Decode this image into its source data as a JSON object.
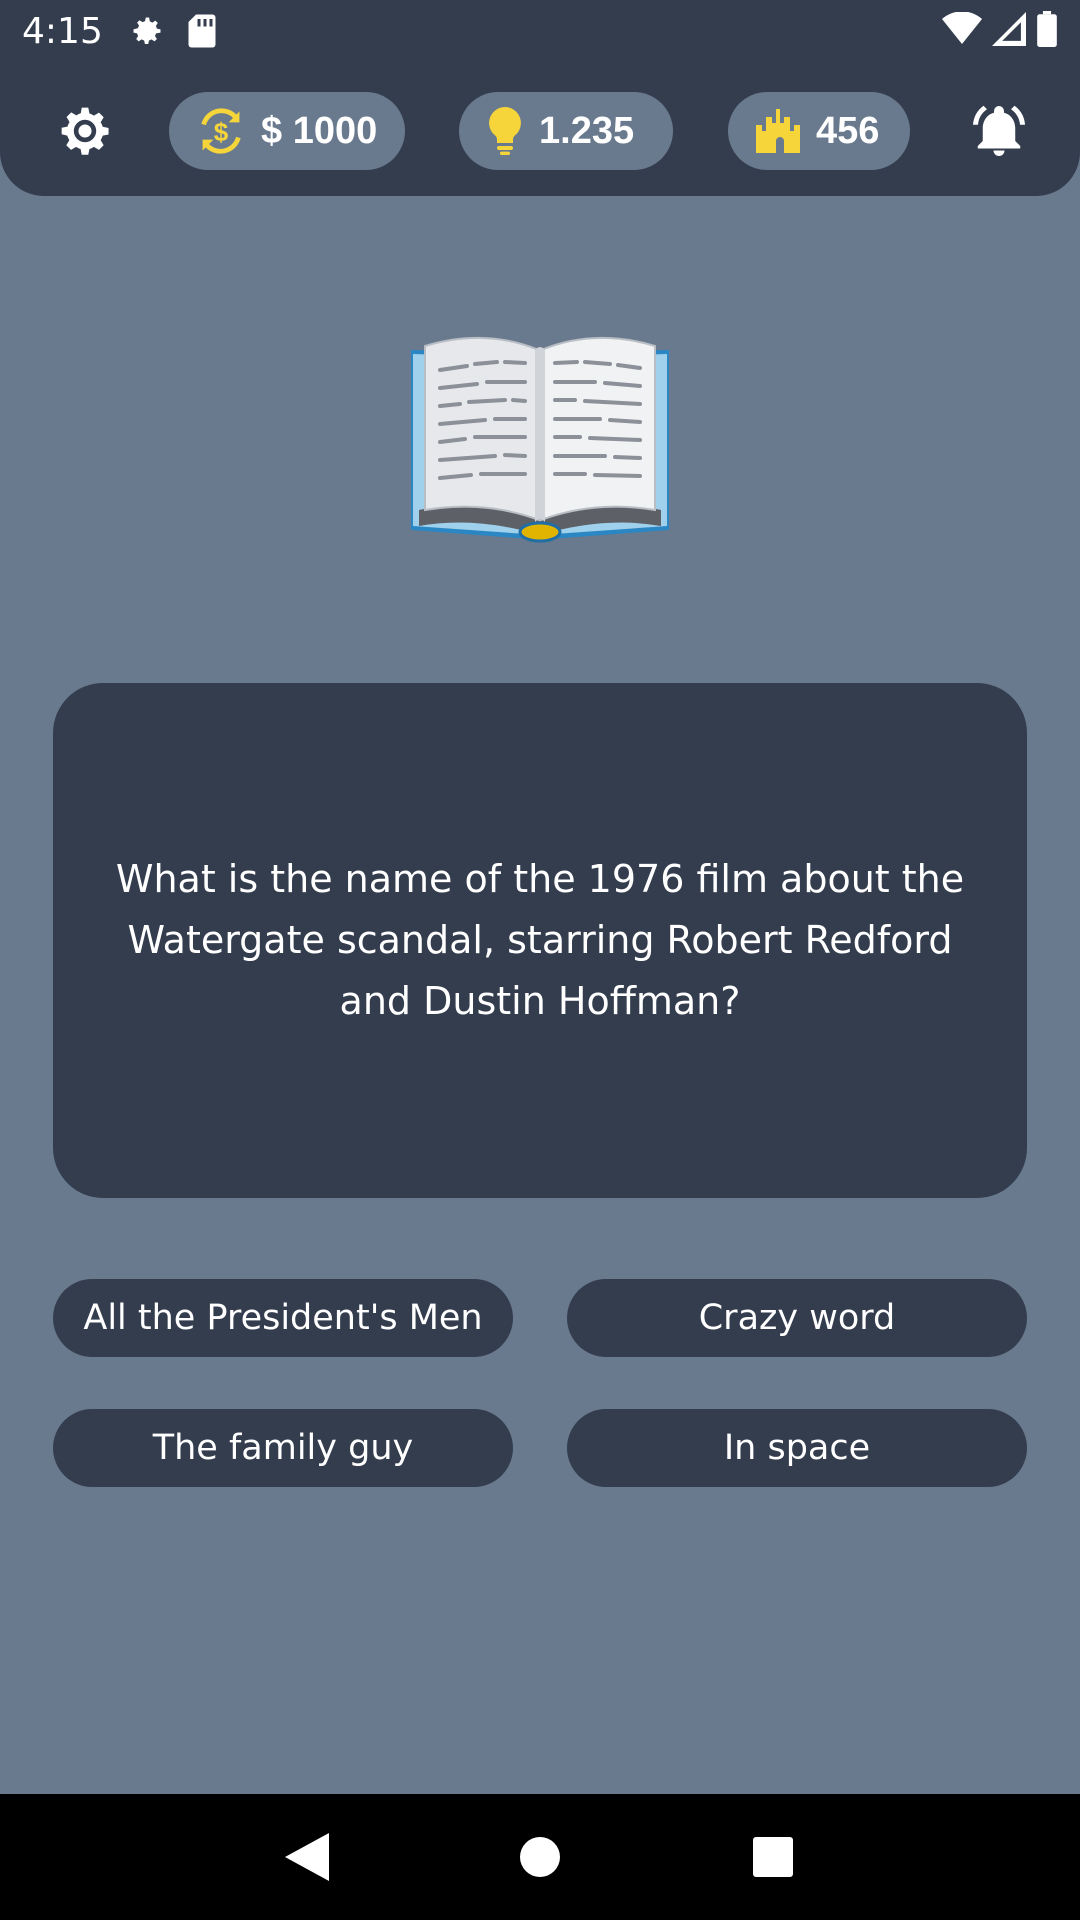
{
  "status_bar": {
    "time": "4:15",
    "icons_left": [
      "gear-icon",
      "sd-card-icon"
    ],
    "icons_right": [
      "wifi-icon",
      "signal-icon",
      "battery-icon"
    ]
  },
  "top_bar": {
    "settings_icon": "gear-icon",
    "money": {
      "icon": "dollar-exchange-icon",
      "label": "$ 1000",
      "icon_color": "#f5d53a"
    },
    "hints": {
      "icon": "lightbulb-icon",
      "label": "1.235",
      "icon_color": "#f5d53a"
    },
    "castle": {
      "icon": "castle-icon",
      "label": "456",
      "icon_color": "#f5d53a"
    },
    "alarm_icon": "bell-alarm-icon"
  },
  "category_image": "open-book-icon",
  "question": {
    "text": "What is the name of the 1976 film about the Watergate scandal, starring Robert Redford and Dustin Hoffman?"
  },
  "answers": [
    {
      "label": "All the President's Men"
    },
    {
      "label": "Crazy word"
    },
    {
      "label": "The family guy"
    },
    {
      "label": "In space"
    }
  ],
  "nav_bar": {
    "back_icon": "back-triangle-icon",
    "home_icon": "home-circle-icon",
    "recents_icon": "recents-square-icon"
  },
  "colors": {
    "background": "#6a7a8e",
    "surface": "#333d4e",
    "accent": "#f5d53a"
  }
}
